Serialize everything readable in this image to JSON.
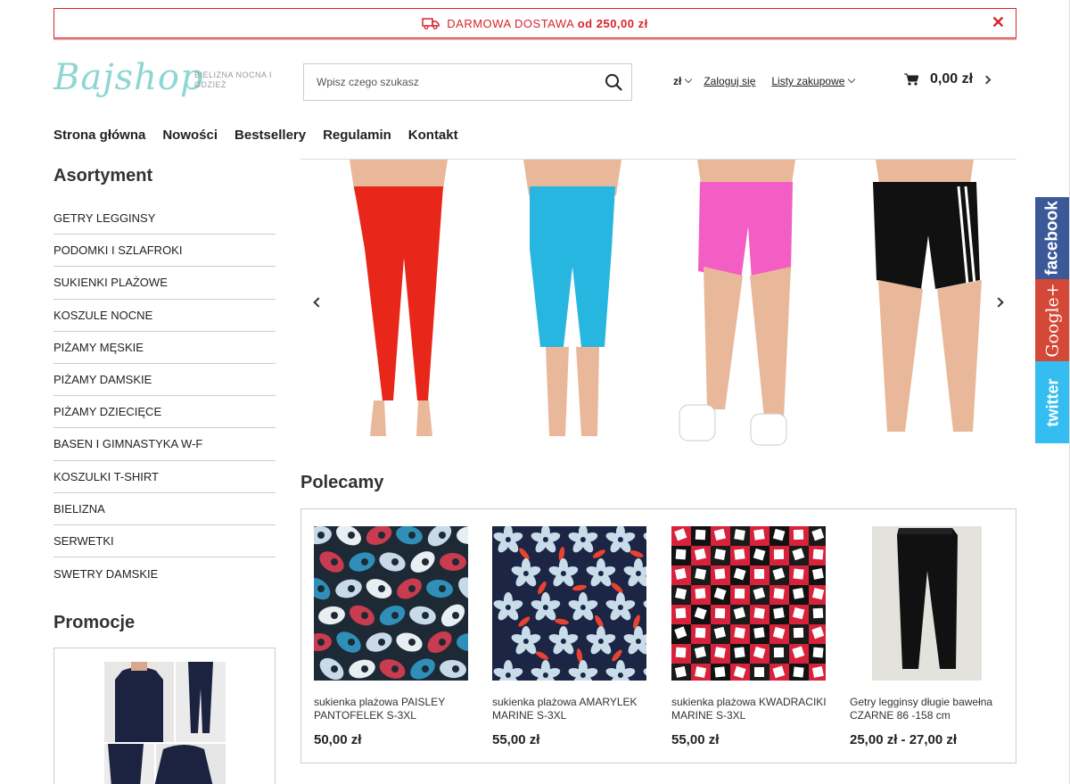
{
  "promo_bar": {
    "icon": "truck-icon",
    "text": "DARMOWA DOSTAWA",
    "amount": "od 250,00 zł",
    "close": "✕",
    "color": "#d8232a"
  },
  "logo": {
    "word": "Bajshop",
    "tagline": "BIELIZNA NOCNA I ODZIEŻ",
    "color": "#8fd6d2"
  },
  "search": {
    "placeholder": "Wpisz czego szukasz",
    "value": ""
  },
  "header": {
    "currency": "zł",
    "login": "Zaloguj się",
    "lists": "Listy zakupowe",
    "cart_amount": "0,00 zł"
  },
  "nav": [
    "Strona główna",
    "Nowości",
    "Bestsellery",
    "Regulamin",
    "Kontakt"
  ],
  "sidebar": {
    "title": "Asortyment",
    "categories": [
      "GETRY LEGGINSY",
      "PODOMKI I SZLAFROKI",
      "SUKIENKI PLAŻOWE",
      "KOSZULE NOCNE",
      "PIŻAMY MĘSKIE",
      "PIŻAMY DAMSKIE",
      "PIŻAMY DZIECIĘCE",
      "BASEN I GIMNASTYKA W-F",
      "KOSZULKI T-SHIRT",
      "BIELIZNA",
      "SERWETKI",
      "SWETRY DAMSKIE"
    ],
    "promo_title": "Promocje"
  },
  "slider": {
    "slide_colors": [
      "#e8261a",
      "#27b6df",
      "#f25ec4",
      "#111111"
    ]
  },
  "recommended": {
    "title": "Polecamy",
    "products": [
      {
        "name": "sukienka plażowa PAISLEY PANTOFELEK S-3XL",
        "price": "50,00 zł"
      },
      {
        "name": "sukienka plażowa AMARYLEK MARINE S-3XL",
        "price": "55,00 zł"
      },
      {
        "name": "sukienka plażowa KWADRACIKI MARINE S-3XL",
        "price": "55,00 zł"
      },
      {
        "name": "Getry legginsy długie bawełna CZARNE 86 -158 cm",
        "price": "25,00 zł - 27,00 zł"
      }
    ]
  },
  "social": {
    "facebook": "facebook",
    "google": "Google+",
    "twitter": "twitter"
  }
}
